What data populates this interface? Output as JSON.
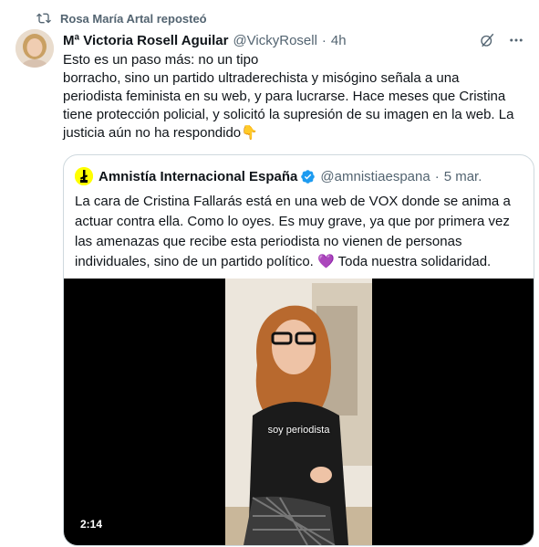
{
  "repost": {
    "icon": "repost-icon",
    "label": "Rosa María Artal reposteó"
  },
  "tweet": {
    "author_name": "Mª Victoria Rosell Aguilar",
    "author_handle": "@VickyRosell",
    "separator": "·",
    "time": "4h",
    "text": "Esto es un paso más: no un tipo\nborracho, sino un partido ultraderechista y misógino señala a una\nperiodista feminista en su web, y para lucrarse. Hace meses que Cristina\ntiene protección policial, y solicitó la supresión de su imagen en la web. La\njusticia aún no ha respondido",
    "emoji": "👇",
    "emoji_icon": "pointing-down-hand-icon"
  },
  "quote": {
    "author_name": "Amnistía Internacional España",
    "author_handle": "@amnistiaespana",
    "separator": "·",
    "date": "5 mar.",
    "text_main": "La cara de Cristina Fallarás está en una web de VOX donde se anima a actuar contra ella. Como lo oyes. Es muy grave, ya que por primera vez las amenazas que recibe esta periodista no vienen de personas individuales, sino de un partido político.",
    "heart": "💜",
    "text_end": " Toda nuestra solidaridad.",
    "video": {
      "caption": "soy periodista",
      "duration": "2:14"
    }
  },
  "colors": {
    "text": "#0f1419",
    "muted": "#536471",
    "border": "#cfd9de",
    "verified": "#1d9bf0",
    "amnesty_yellow": "#ffff00",
    "heart": "#a582d2"
  }
}
